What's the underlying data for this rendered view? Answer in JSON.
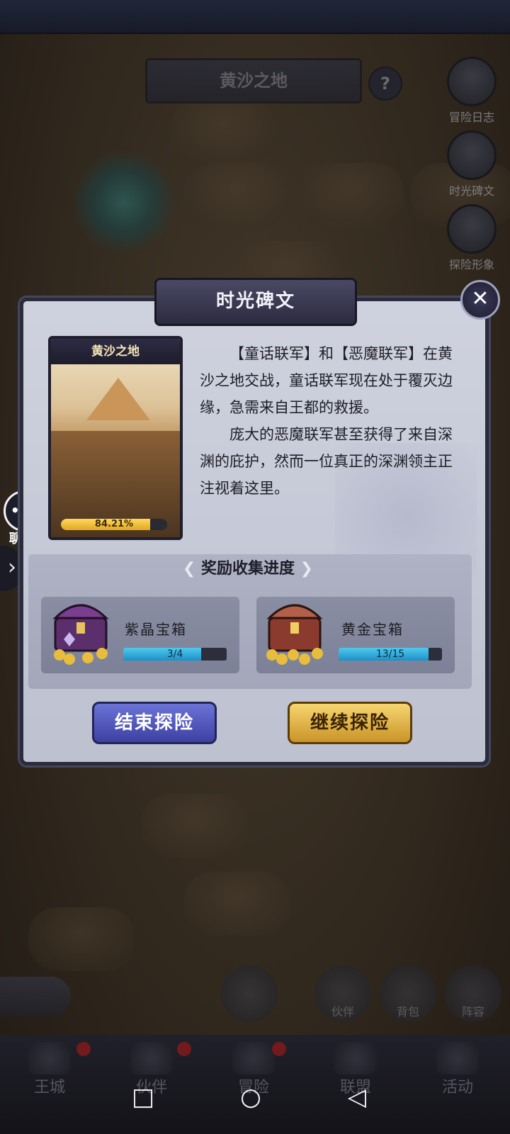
{
  "background": {
    "map_title": "黄沙之地",
    "help_label": "?",
    "side_buttons": [
      {
        "label": "冒险日志",
        "icon": "scroll-icon"
      },
      {
        "label": "时光碑文",
        "icon": "tablet-icon"
      },
      {
        "label": "探险形象",
        "icon": "avatar-icon"
      }
    ],
    "bottom_buttons": [
      {
        "label": "伙伴"
      },
      {
        "label": "背包"
      },
      {
        "label": "阵容"
      }
    ]
  },
  "dialog": {
    "title": "时光碑文",
    "close_label": "✕",
    "card": {
      "title": "黄沙之地",
      "progress_text": "84.21%",
      "progress": 84.21
    },
    "story": [
      "【童话联军】和【恶魔联军】在黄沙之地交战，童话联军现在处于覆灭边缘，急需来自王都的救援。",
      "庞大的恶魔联军甚至获得了来自深渊的庇护，然而一位真正的深渊领主正注视着这里。"
    ],
    "reward_section": {
      "title": "奖励收集进度",
      "chests": [
        {
          "name": "紫晶宝箱",
          "progress_text": "3/4",
          "progress": 0.75
        },
        {
          "name": "黄金宝箱",
          "progress_text": "13/15",
          "progress": 0.8667
        }
      ]
    },
    "buttons": {
      "end": "结束探险",
      "continue": "继续探险"
    }
  },
  "chat": {
    "bubble": "•••",
    "label": "聊 天"
  },
  "expand_label": "›",
  "nav": [
    {
      "label": "王城",
      "dot": true
    },
    {
      "label": "伙伴",
      "dot": true
    },
    {
      "label": "冒险",
      "dot": true
    },
    {
      "label": "联盟",
      "dot": false
    },
    {
      "label": "活动",
      "dot": false
    }
  ],
  "system_nav": {
    "recent": "□",
    "home": "○",
    "back": "◁"
  },
  "colors": {
    "end_button": "#4a50b8",
    "continue_button": "#e2b23f",
    "progress_fill": "#2aa6dc",
    "card_progress_fill": "#f3c43f"
  }
}
